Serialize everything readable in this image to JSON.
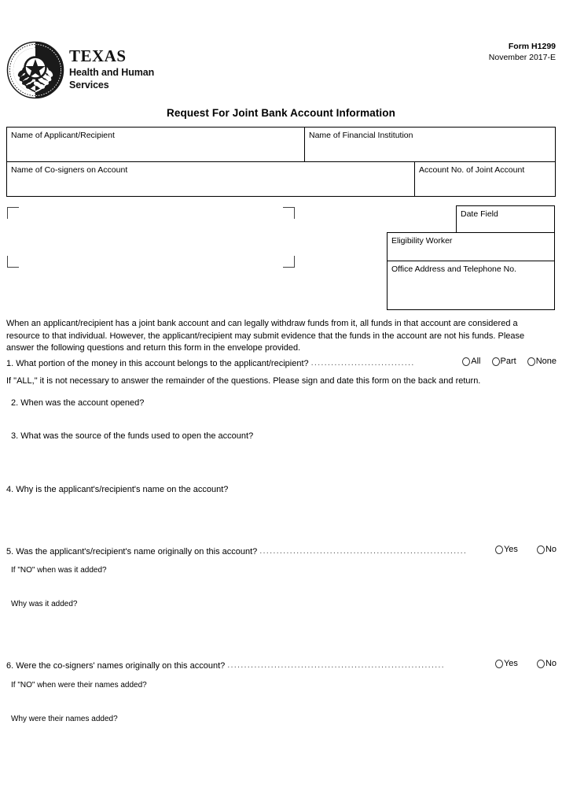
{
  "header": {
    "logo": {
      "seal_icon": "texas-state-seal-icon",
      "state": "TEXAS",
      "line1": "Health and Human",
      "line2": "Services"
    },
    "form_number": "Form H1299",
    "form_date": "November 2017-E"
  },
  "title": "Request For Joint Bank Account Information",
  "table": {
    "row1": [
      {
        "label": "Name of Applicant/Recipient"
      },
      {
        "label": "Name of Financial Institution"
      }
    ],
    "row2": [
      {
        "label": "Name of Co-signers on Account"
      },
      {
        "label": "Account No. of Joint Account"
      }
    ]
  },
  "right_boxes": {
    "date_field": "Date Field",
    "eligibility_worker": "Eligibility Worker",
    "office_address": "Office Address and Telephone No."
  },
  "intro_paragraph": "When an applicant/recipient has a joint bank account and can legally withdraw funds from it, all funds in that account are considered a resource to that individual. However, the applicant/recipient may submit evidence that the funds in the account are not his funds. Please answer the following questions and return this form in the envelope provided.",
  "questions": [
    {
      "id": "q1",
      "text": "1. What portion of the money in this account belongs to the applicant/recipient?",
      "leader": "...............................",
      "options": [
        "All",
        "Part",
        "None"
      ]
    },
    {
      "id": "q2",
      "text": "2. When was the account opened?"
    },
    {
      "id": "q3",
      "text": "3. What was the source of the funds used to open the account?"
    },
    {
      "id": "q4",
      "text": "4. Why is the applicant's/recipient's name on the account?"
    },
    {
      "id": "q5",
      "text": "5. Was the applicant's/recipient's name originally on this account?",
      "leader": "..............................................................",
      "options": [
        "Yes",
        "No"
      ],
      "sub": [
        "If \"NO\" when was it added?",
        "Why was it added?"
      ]
    },
    {
      "id": "q6",
      "text": "6. Were the co-signers' names originally on this account?",
      "leader": ".................................................................",
      "options": [
        "Yes",
        "No"
      ],
      "sub": [
        "If \"NO\" when were their names added?",
        "Why were their names added?"
      ]
    }
  ],
  "note_after_q1": "If \"ALL,\" it is not necessary to answer the remainder of the questions. Please sign and date this form on the back and return.",
  "colors": {
    "ink": "#000000",
    "paper": "#ffffff",
    "rule": "#000000",
    "bracket": "#444444",
    "leader": "#555555"
  }
}
